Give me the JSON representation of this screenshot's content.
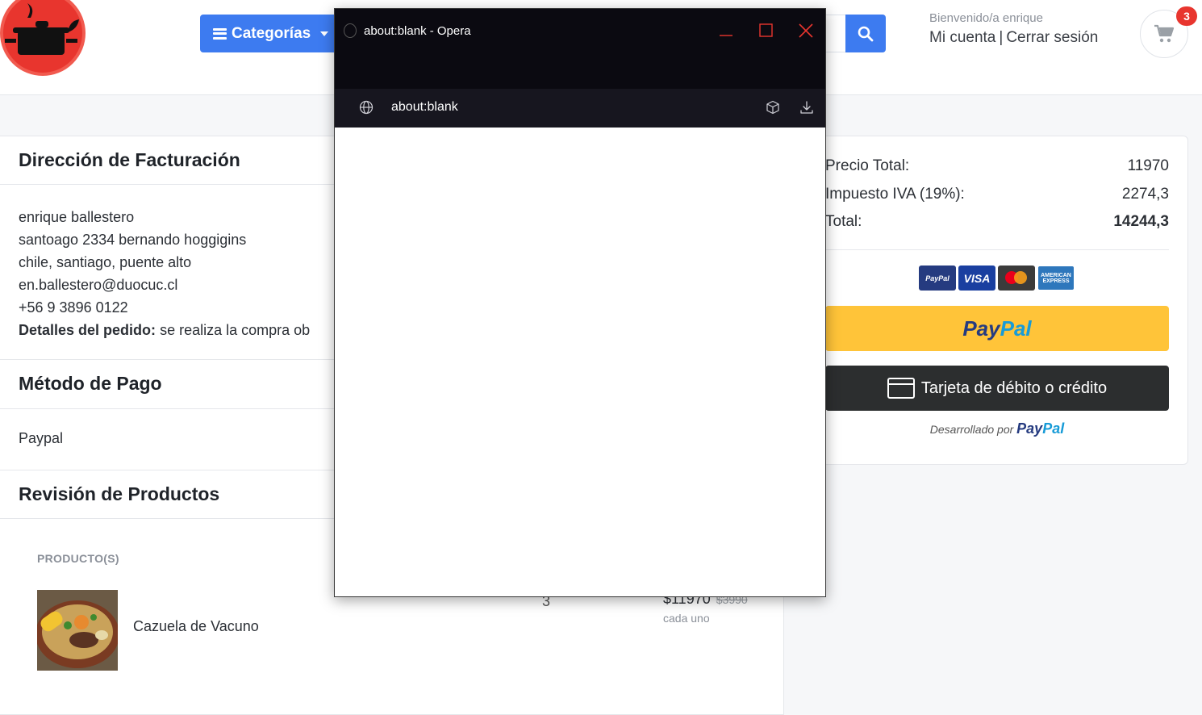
{
  "header": {
    "categories_label": "Categorías",
    "welcome": "Bienvenido/a enrique",
    "my_account": "Mi cuenta",
    "separator": "|",
    "logout": "Cerrar sesión",
    "cart_count": "3"
  },
  "billing": {
    "title": "Dirección de Facturación",
    "name": "enrique ballestero",
    "street": "santoago 2334 bernando hoggigins",
    "location": "chile, santiago, puente alto",
    "email": "en.ballestero@duocuc.cl",
    "phone": "+56 9 3896 0122",
    "details_label": "Detalles del pedido:",
    "details_value": "se realiza la compra ob"
  },
  "payment": {
    "title": "Método de Pago",
    "method": "Paypal"
  },
  "review": {
    "title": "Revisión de Productos",
    "column_product": "PRODUCTO(S)",
    "items": [
      {
        "name": "Cazuela de Vacuno",
        "quantity": "3",
        "price": "$11970",
        "unit_price": "$3990",
        "each_label": "cada uno"
      }
    ]
  },
  "summary": {
    "subtotal_label": "Precio Total:",
    "subtotal_value": "11970",
    "tax_label": "Impuesto IVA (19%):",
    "tax_value": "2274,3",
    "total_label": "Total:",
    "total_value": "14244,3",
    "card_logos": [
      "PayPal",
      "VISA",
      "Mastercard",
      "AMERICAN EXPRESS"
    ],
    "paypal_pay": "Pay",
    "paypal_pal": "Pal",
    "card_button_label": "Tarjeta de débito o crédito",
    "powered_by": "Desarrollado por",
    "powered_pay": "Pay",
    "powered_pal": "Pal",
    "colors": {
      "paypal_yellow": "#ffc439",
      "paypal_navy": "#253b80",
      "paypal_blue": "#179bd7"
    }
  },
  "popup": {
    "window_title": "about:blank - Opera",
    "url": "about:blank"
  },
  "colors": {
    "accent_blue": "#3d7bf0",
    "brand_red": "#e8352e"
  }
}
